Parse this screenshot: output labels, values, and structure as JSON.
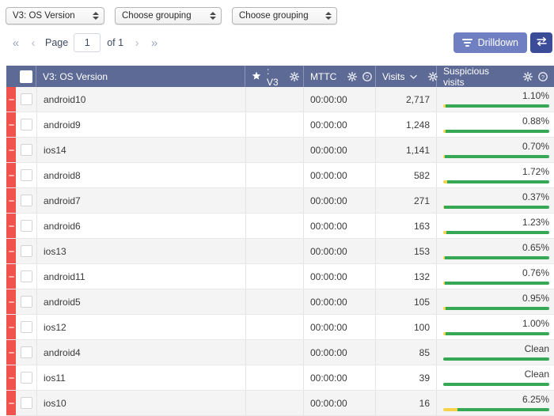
{
  "filters": [
    {
      "value": "V3: OS Version",
      "name": "grouping-select-1"
    },
    {
      "value": "Choose grouping",
      "name": "grouping-select-2"
    },
    {
      "value": "Choose grouping",
      "name": "grouping-select-3"
    }
  ],
  "pagination": {
    "first_label": "«",
    "prev_label": "‹",
    "page_label": "Page",
    "page_value": "1",
    "of_label": "of 1",
    "next_label": "›",
    "last_label": "»"
  },
  "toolbar": {
    "drilldown_label": "Drilldown",
    "drilldown_icon": "funnel-icon",
    "swap_icon": "exchange-arrows-icon",
    "drilldown_color": "#6f7fc1",
    "swap_color": "#3b4d99"
  },
  "table": {
    "header_color": "#5d6a95",
    "stripe_color": "#f0524d",
    "bar_green": "#35a853",
    "bar_yellow": "#f5d44c",
    "columns": [
      {
        "key": "name",
        "label": "V3: OS Version",
        "icons": []
      },
      {
        "key": "star",
        "label": ": V3",
        "icons": [
          "star-icon",
          "gear-icon"
        ]
      },
      {
        "key": "mttc",
        "label": "MTTC",
        "icons": [
          "gear-icon",
          "help-icon"
        ]
      },
      {
        "key": "visits",
        "label": "Visits",
        "icons": [
          "chevron-down-icon",
          "gear-icon"
        ]
      },
      {
        "key": "susp",
        "label": "Suspicious visits",
        "icons": [
          "gear-icon",
          "help-icon"
        ]
      }
    ],
    "rows": [
      {
        "name": "android10",
        "star": "",
        "mttc": "00:00:00",
        "visits": "2,717",
        "susp": "1.10%",
        "susp_pct": 1.1
      },
      {
        "name": "android9",
        "star": "",
        "mttc": "00:00:00",
        "visits": "1,248",
        "susp": "0.88%",
        "susp_pct": 0.88
      },
      {
        "name": "ios14",
        "star": "",
        "mttc": "00:00:00",
        "visits": "1,141",
        "susp": "0.70%",
        "susp_pct": 0.7
      },
      {
        "name": "android8",
        "star": "",
        "mttc": "00:00:00",
        "visits": "582",
        "susp": "1.72%",
        "susp_pct": 1.72
      },
      {
        "name": "android7",
        "star": "",
        "mttc": "00:00:00",
        "visits": "271",
        "susp": "0.37%",
        "susp_pct": 0.37
      },
      {
        "name": "android6",
        "star": "",
        "mttc": "00:00:00",
        "visits": "163",
        "susp": "1.23%",
        "susp_pct": 1.23
      },
      {
        "name": "ios13",
        "star": "",
        "mttc": "00:00:00",
        "visits": "153",
        "susp": "0.65%",
        "susp_pct": 0.65
      },
      {
        "name": "android11",
        "star": "",
        "mttc": "00:00:00",
        "visits": "132",
        "susp": "0.76%",
        "susp_pct": 0.76
      },
      {
        "name": "android5",
        "star": "",
        "mttc": "00:00:00",
        "visits": "105",
        "susp": "0.95%",
        "susp_pct": 0.95
      },
      {
        "name": "ios12",
        "star": "",
        "mttc": "00:00:00",
        "visits": "100",
        "susp": "1.00%",
        "susp_pct": 1.0
      },
      {
        "name": "android4",
        "star": "",
        "mttc": "00:00:00",
        "visits": "85",
        "susp": "Clean",
        "susp_pct": 0
      },
      {
        "name": "ios11",
        "star": "",
        "mttc": "00:00:00",
        "visits": "39",
        "susp": "Clean",
        "susp_pct": 0
      },
      {
        "name": "ios10",
        "star": "",
        "mttc": "00:00:00",
        "visits": "16",
        "susp": "6.25%",
        "susp_pct": 6.25
      }
    ]
  }
}
